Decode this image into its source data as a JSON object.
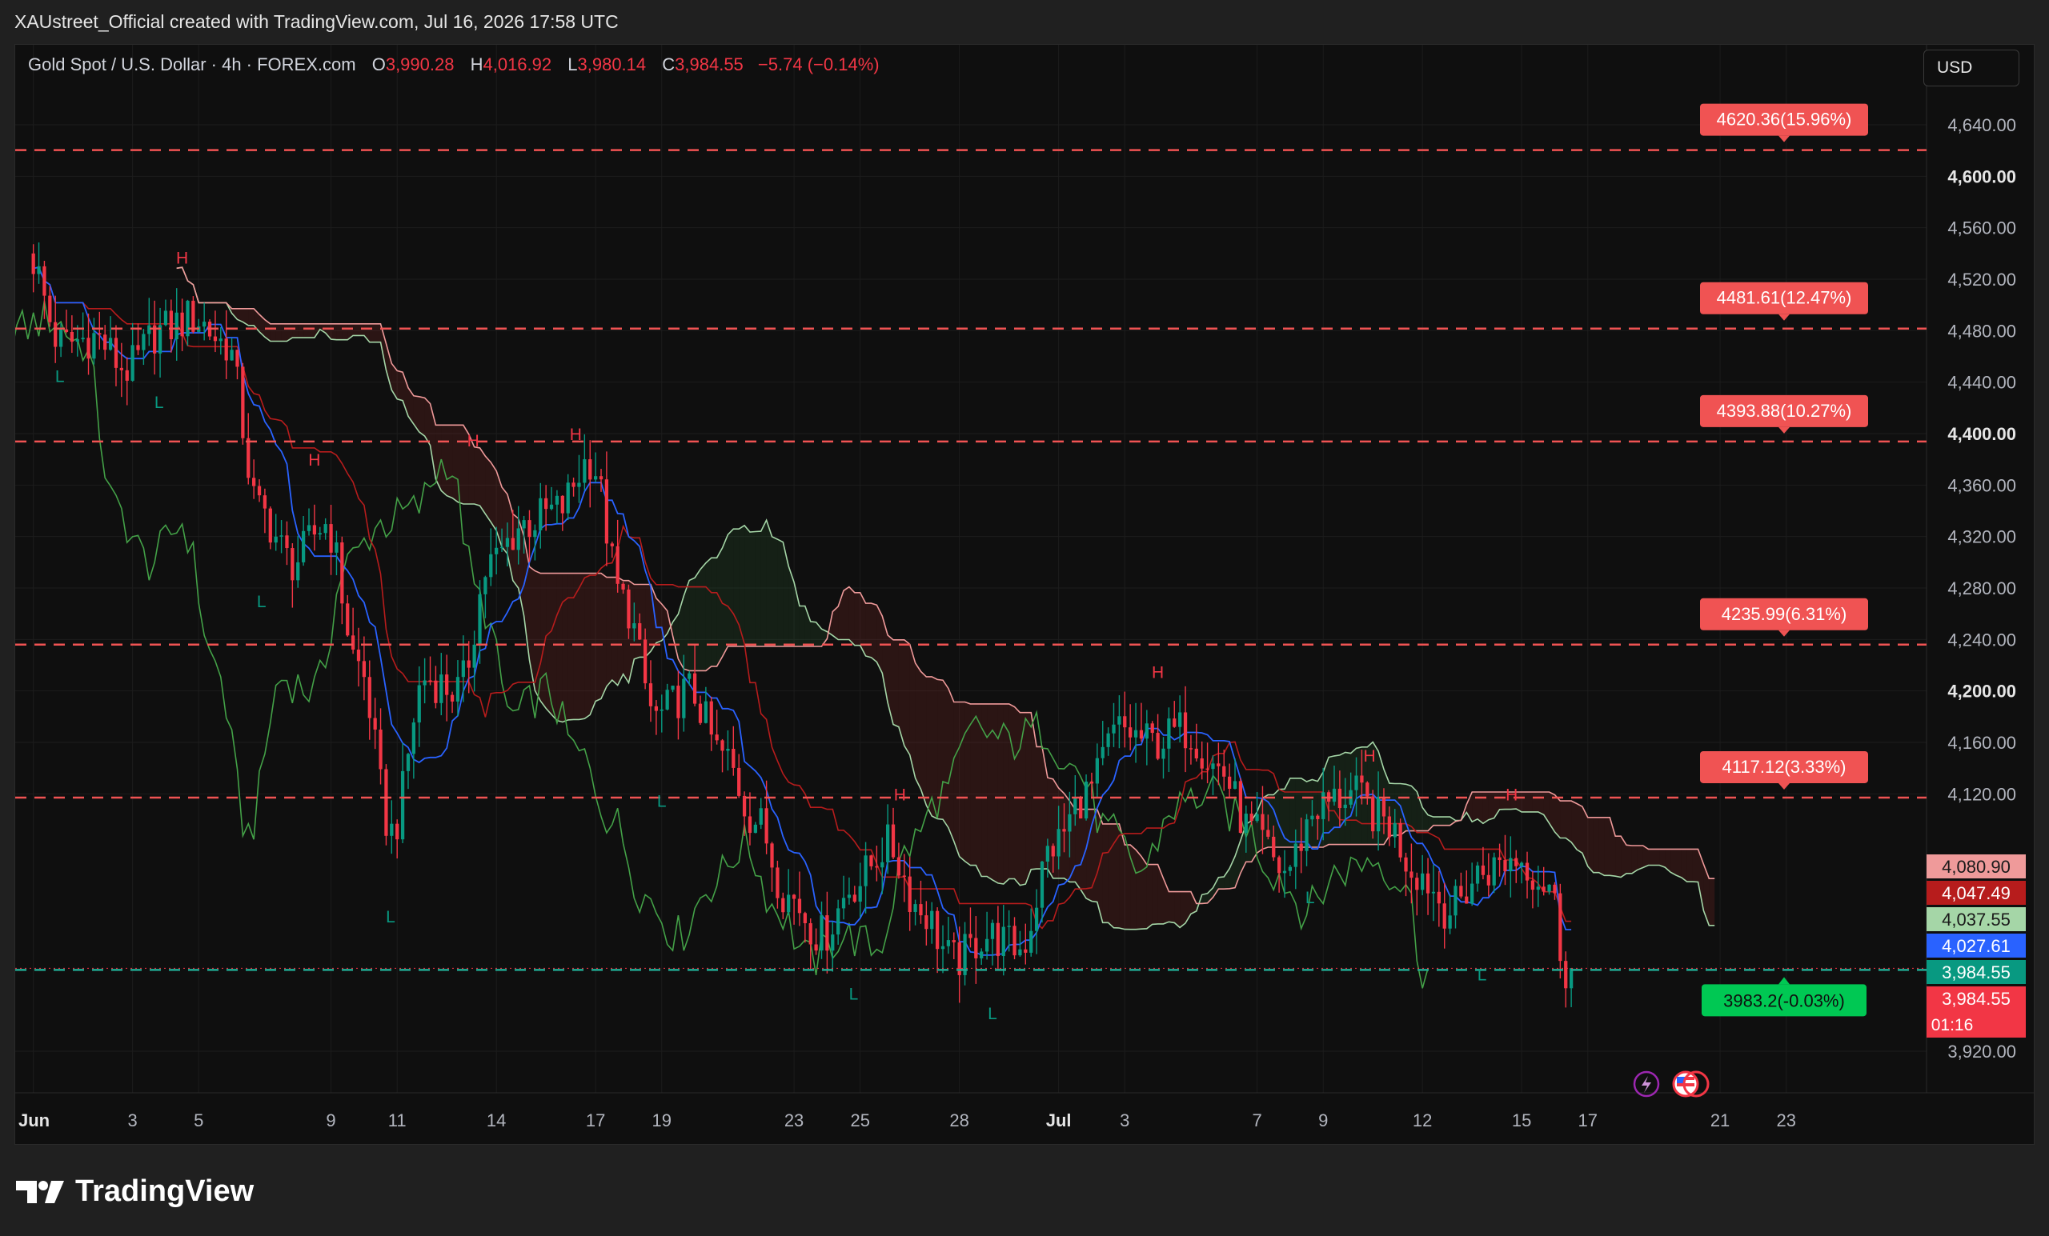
{
  "caption": "XAUstreet_Official created with TradingView.com, Jul 16, 2026 17:58 UTC",
  "legend": {
    "symbol": "Gold Spot / U.S. Dollar · 4h · FOREX.com",
    "o_label": "O",
    "o_value": "3,990.28",
    "h_label": "H",
    "h_value": "4,016.92",
    "l_label": "L",
    "l_value": "3,980.14",
    "c_label": "C",
    "c_value": "3,984.55",
    "change": "−5.74 (−0.14%)"
  },
  "currency": "USD",
  "brand": "TradingView",
  "icons": [
    "tradingview-logo-icon",
    "lightning-icon",
    "us-flag-icon"
  ],
  "colors": {
    "bear": "#f23645",
    "bull": "#089981",
    "tenkan": "#2962ff",
    "kijun": "#b71c1c",
    "chikou": "#43a047",
    "span_a": "#a5d6a7",
    "span_b": "#ef9a9a",
    "target_line": "#f05353",
    "current_line": "#22ab94"
  },
  "chart_data": {
    "type": "candlestick",
    "symbol": "XAUUSD",
    "timeframe": "4h",
    "y_ticks": [
      4640,
      4600,
      4560,
      4520,
      4480,
      4440,
      4400,
      4360,
      4320,
      4280,
      4240,
      4200,
      4160,
      4120,
      3920
    ],
    "y_tick_labels": [
      "4,640.00",
      "4,600.00",
      "4,560.00",
      "4,520.00",
      "4,480.00",
      "4,440.00",
      "4,400.00",
      "4,360.00",
      "4,320.00",
      "4,280.00",
      "4,240.00",
      "4,200.00",
      "4,160.00",
      "4,120.00",
      "3,920.00"
    ],
    "y_bold_ticks": [
      4600,
      4400,
      4200
    ],
    "ylim": [
      3900,
      4670
    ],
    "x_ticks": [
      {
        "label": "Jun",
        "day": 0,
        "bold": true
      },
      {
        "label": "3",
        "day": 3
      },
      {
        "label": "5",
        "day": 5
      },
      {
        "label": "9",
        "day": 9
      },
      {
        "label": "11",
        "day": 11
      },
      {
        "label": "14",
        "day": 14
      },
      {
        "label": "17",
        "day": 17
      },
      {
        "label": "19",
        "day": 19
      },
      {
        "label": "23",
        "day": 23
      },
      {
        "label": "25",
        "day": 25
      },
      {
        "label": "28",
        "day": 28
      },
      {
        "label": "Jul",
        "day": 31,
        "bold": true
      },
      {
        "label": "3",
        "day": 33
      },
      {
        "label": "7",
        "day": 37
      },
      {
        "label": "9",
        "day": 39
      },
      {
        "label": "12",
        "day": 42
      },
      {
        "label": "15",
        "day": 45
      },
      {
        "label": "17",
        "day": 47
      },
      {
        "label": "21",
        "day": 51
      },
      {
        "label": "23",
        "day": 53
      }
    ],
    "xlim_days": [
      -0.5,
      57
    ],
    "last_bar_day": 46.5,
    "price_points": [
      [
        0,
        4540
      ],
      [
        1,
        4470
      ],
      [
        2,
        4475
      ],
      [
        3,
        4450
      ],
      [
        4,
        4480
      ],
      [
        5,
        4490
      ],
      [
        6,
        4470
      ],
      [
        7,
        4340
      ],
      [
        8,
        4300
      ],
      [
        9,
        4330
      ],
      [
        10,
        4220
      ],
      [
        11,
        4090
      ],
      [
        12,
        4210
      ],
      [
        13,
        4200
      ],
      [
        14,
        4300
      ],
      [
        15,
        4330
      ],
      [
        16,
        4340
      ],
      [
        17,
        4380
      ],
      [
        18,
        4270
      ],
      [
        19,
        4180
      ],
      [
        20,
        4200
      ],
      [
        21,
        4150
      ],
      [
        22,
        4100
      ],
      [
        23,
        4040
      ],
      [
        24,
        4010
      ],
      [
        25,
        4050
      ],
      [
        26,
        4080
      ],
      [
        27,
        4030
      ],
      [
        28,
        3990
      ],
      [
        29,
        4010
      ],
      [
        30,
        4000
      ],
      [
        31,
        4080
      ],
      [
        32,
        4120
      ],
      [
        33,
        4170
      ],
      [
        34,
        4160
      ],
      [
        35,
        4170
      ],
      [
        36,
        4140
      ],
      [
        37,
        4090
      ],
      [
        38,
        4060
      ],
      [
        39,
        4110
      ],
      [
        40,
        4120
      ],
      [
        41,
        4100
      ],
      [
        42,
        4060
      ],
      [
        43,
        4030
      ],
      [
        44,
        4060
      ],
      [
        45,
        4070
      ],
      [
        46,
        4050
      ],
      [
        46.5,
        3984.55
      ]
    ],
    "target_levels": [
      {
        "price": 4620.36,
        "label": "4620.36(15.96%)"
      },
      {
        "price": 4481.61,
        "label": "4481.61(12.47%)"
      },
      {
        "price": 4393.88,
        "label": "4393.88(10.27%)"
      },
      {
        "price": 4235.99,
        "label": "4235.99(6.31%)"
      },
      {
        "price": 4117.12,
        "label": "4117.12(3.33%)"
      }
    ],
    "current_level": {
      "price": 3983.2,
      "label": "3983.2(-0.03%)"
    },
    "price_tags": [
      {
        "price": 4080.9,
        "label": "4,080.90",
        "color": "#ef9a9a",
        "text_color": "#1a1a1a"
      },
      {
        "price": 4047.49,
        "label": "4,047.49",
        "color": "#b71c1c",
        "text_color": "#ffffff"
      },
      {
        "price": 4037.55,
        "label": "4,037.55",
        "color": "#a5d6a7",
        "text_color": "#1a1a1a"
      },
      {
        "price": 4027.61,
        "label": "4,027.61",
        "color": "#2962ff",
        "text_color": "#ffffff"
      },
      {
        "price": 3984.55,
        "label": "3,984.55",
        "color": "#089981",
        "text_color": "#ffffff"
      },
      {
        "price": 3984.55,
        "label": "3,984.55",
        "color": "#f23645",
        "text_color": "#ffffff",
        "sub": "01:16"
      }
    ],
    "pivot_markers": [
      {
        "day": 4.5,
        "price": 4532,
        "label": "H"
      },
      {
        "day": 0.8,
        "price": 4440,
        "label": "L"
      },
      {
        "day": 3.8,
        "price": 4420,
        "label": "L"
      },
      {
        "day": 8.5,
        "price": 4375,
        "label": "H"
      },
      {
        "day": 6.9,
        "price": 4265,
        "label": "L"
      },
      {
        "day": 13.3,
        "price": 4390,
        "label": "H"
      },
      {
        "day": 16.4,
        "price": 4395,
        "label": "H"
      },
      {
        "day": 10.8,
        "price": 4020,
        "label": "L"
      },
      {
        "day": 19.0,
        "price": 4110,
        "label": "L"
      },
      {
        "day": 24.8,
        "price": 3960,
        "label": "L"
      },
      {
        "day": 26.2,
        "price": 4115,
        "label": "H"
      },
      {
        "day": 29.0,
        "price": 3945,
        "label": "L"
      },
      {
        "day": 34.0,
        "price": 4210,
        "label": "H"
      },
      {
        "day": 38.6,
        "price": 4035,
        "label": "L"
      },
      {
        "day": 40.4,
        "price": 4145,
        "label": "H"
      },
      {
        "day": 43.8,
        "price": 3975,
        "label": "L"
      },
      {
        "day": 44.7,
        "price": 4115,
        "label": "H"
      }
    ],
    "indicators": [
      "Ichimoku Cloud (Tenkan, Kijun, Chikou, Span A, Span B)",
      "Pivot Points High Low"
    ],
    "grid": true
  }
}
